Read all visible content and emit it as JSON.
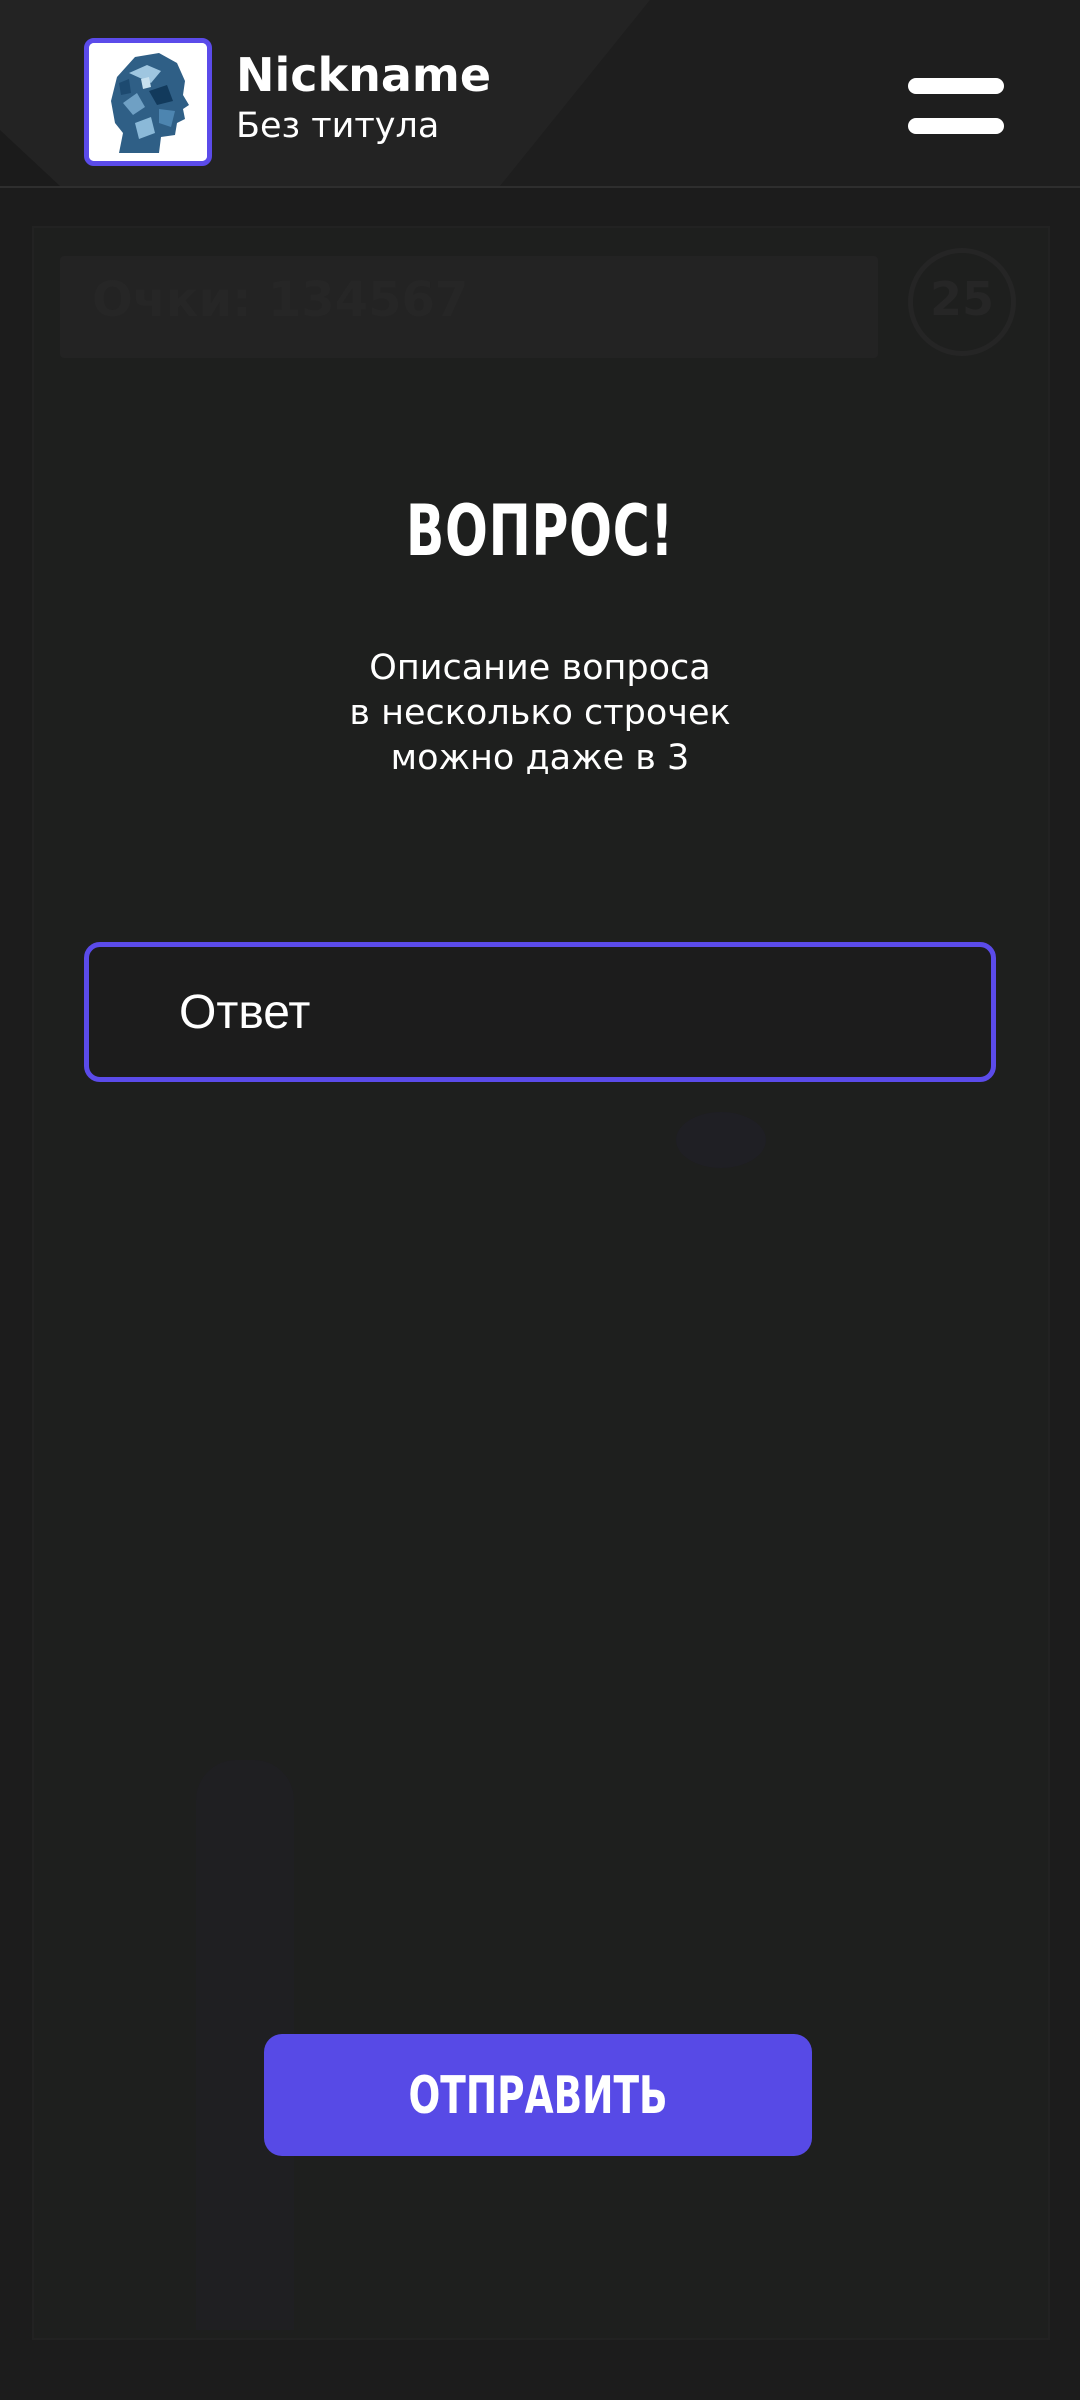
{
  "header": {
    "nickname": "Nickname",
    "user_title": "Без титула",
    "avatar_icon": "head-avatar-image",
    "menu_icon": "hamburger-menu-icon"
  },
  "game": {
    "score_label": "Очки: 134567",
    "timer_value": "25"
  },
  "question": {
    "title": "ВОПРОС!",
    "description": "Описание вопроса\nв несколько строчек\nможно даже в 3"
  },
  "answer": {
    "placeholder": "Ответ",
    "value": ""
  },
  "submit": {
    "label": "ОТПРАВИТЬ"
  },
  "colors": {
    "accent": "#574ae6",
    "background": "#1c1c1c",
    "text": "#ffffff"
  }
}
